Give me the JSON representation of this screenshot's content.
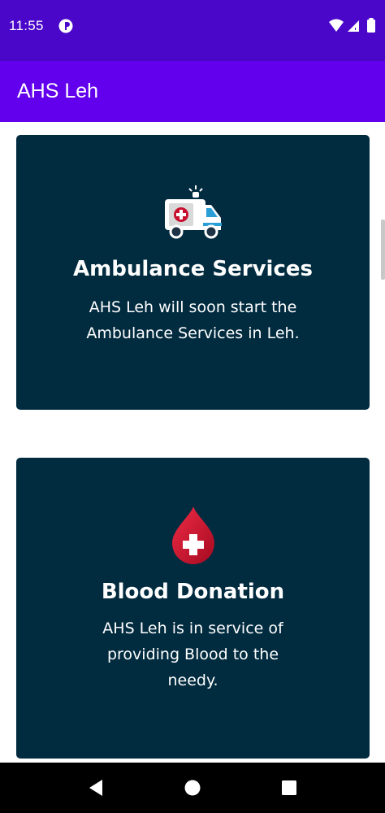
{
  "status_bar": {
    "time": "11:55",
    "app_icon": "circular-app-icon",
    "icons": [
      "wifi-icon",
      "cell-signal-icon",
      "battery-icon"
    ]
  },
  "app_bar": {
    "title": "AHS Leh"
  },
  "cards": [
    {
      "icon": "ambulance-icon",
      "title": "Ambulance Services",
      "text": "AHS Leh will soon start the Ambulance Services in Leh."
    },
    {
      "icon": "blood-drop-icon",
      "title": "Blood Donation",
      "text": "AHS Leh is in service of providing Blood to the needy."
    }
  ],
  "nav_bar": {
    "buttons": [
      "back-button",
      "home-button",
      "recents-button"
    ]
  },
  "colors": {
    "status_bar": "#4a07c9",
    "app_bar": "#6200ee",
    "card_background": "#012b3f",
    "blood_red": "#c8102e"
  }
}
